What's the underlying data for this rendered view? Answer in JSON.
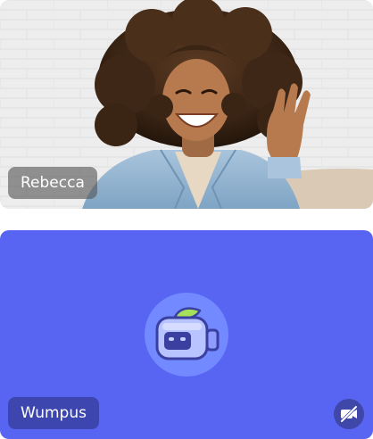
{
  "participants": [
    {
      "name": "Rebecca",
      "video": "on"
    },
    {
      "name": "Wumpus",
      "video": "off"
    }
  ],
  "colors": {
    "tile_bg_video_off": "#5865f2",
    "avatar_bg": "#7289ff",
    "overlay_dark": "#3f47a8"
  },
  "icons": {
    "tile_2_avatar": "wumpus-robot-avatar",
    "tile_2_status": "camera-off-icon"
  }
}
